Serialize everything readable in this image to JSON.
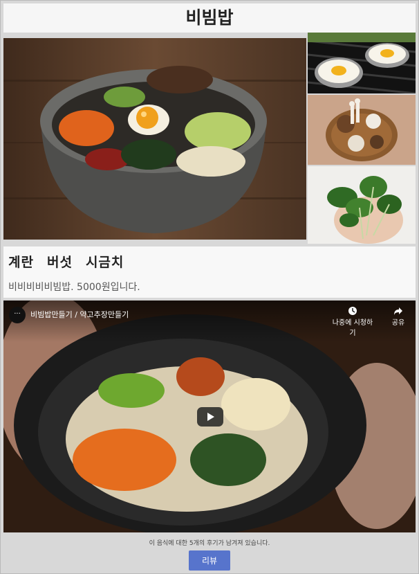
{
  "page": {
    "title": "비빔밥"
  },
  "images": {
    "main": "bibimbap-stone-bowl",
    "thumbnails": [
      "fried-eggs",
      "mushrooms",
      "spinach"
    ]
  },
  "info": {
    "ingredients": [
      "계란",
      "버섯",
      "시금치"
    ],
    "description": "비비비비비빔밥. 5000원입니다."
  },
  "video": {
    "title": "비빔밥만들기 / 약고추장만들기",
    "watch_later_label": "나중에 시청하기",
    "share_label": "공유",
    "icons": {
      "channel": "channel-avatar",
      "watch_later": "clock-icon",
      "share": "share-icon",
      "play": "play-icon"
    }
  },
  "footer": {
    "review_note": "이 음식에 대한 5개의 후기가 남겨져 있습니다.",
    "review_button": "리뷰"
  },
  "colors": {
    "button": "#5774cc",
    "background": "#d8d8d8",
    "card": "#f8f8f8"
  }
}
